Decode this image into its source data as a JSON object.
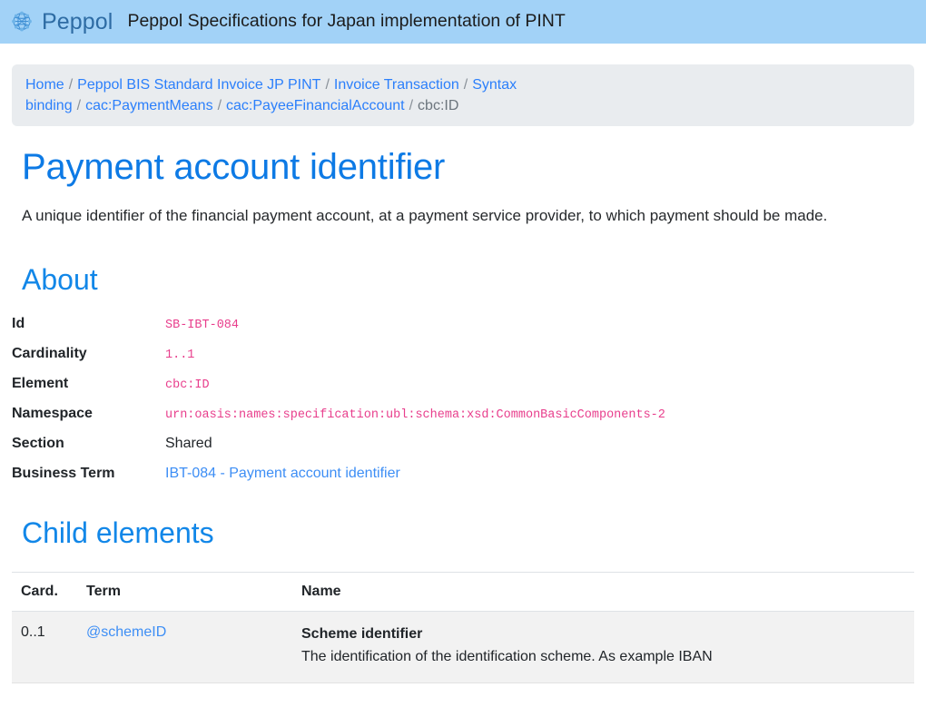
{
  "header": {
    "logo_icon": "peppol-globe-logo-icon",
    "brand_name": "Peppol",
    "site_title": "Peppol Specifications for Japan implementation of PINT",
    "background_color": "#a2d2f7",
    "brand_color": "#2e6ca4"
  },
  "breadcrumb": {
    "separator": "/",
    "items": [
      {
        "label": "Home",
        "is_link": true
      },
      {
        "label": "Peppol BIS Standard Invoice JP PINT",
        "is_link": true
      },
      {
        "label": "Invoice Transaction",
        "is_link": true
      },
      {
        "label": "Syntax binding",
        "is_link": true
      },
      {
        "label": "cac:PaymentMeans",
        "is_link": true
      },
      {
        "label": "cac:PayeeFinancialAccount",
        "is_link": true
      },
      {
        "label": "cbc:ID",
        "is_link": false
      }
    ]
  },
  "main": {
    "title": "Payment account identifier",
    "description": "A unique identifier of the financial payment account, at a payment service provider, to which payment should be made.",
    "about": {
      "heading": "About",
      "rows": [
        {
          "label": "Id",
          "value": "SB-IBT-084",
          "style": "code"
        },
        {
          "label": "Cardinality",
          "value": "1..1",
          "style": "code"
        },
        {
          "label": "Element",
          "value": "cbc:ID",
          "style": "code"
        },
        {
          "label": "Namespace",
          "value": "urn:oasis:names:specification:ubl:schema:xsd:CommonBasicComponents-2",
          "style": "code"
        },
        {
          "label": "Section",
          "value": "Shared",
          "style": "text"
        },
        {
          "label": "Business Term",
          "value": "IBT-084 - Payment account identifier",
          "style": "link"
        }
      ]
    },
    "child_elements": {
      "heading": "Child elements",
      "columns": [
        "Card.",
        "Term",
        "Name"
      ],
      "rows": [
        {
          "card": "0..1",
          "term": "@schemeID",
          "name_title": "Scheme identifier",
          "name_desc": "The identification of the identification scheme. As example IBAN"
        }
      ]
    }
  },
  "colors": {
    "heading_blue": "#0d7ae5",
    "link_blue": "#2b7ffb",
    "code_pink": "#e83e8c",
    "breadcrumb_bg": "#e9ecef",
    "table_row_bg": "#f2f2f2"
  }
}
